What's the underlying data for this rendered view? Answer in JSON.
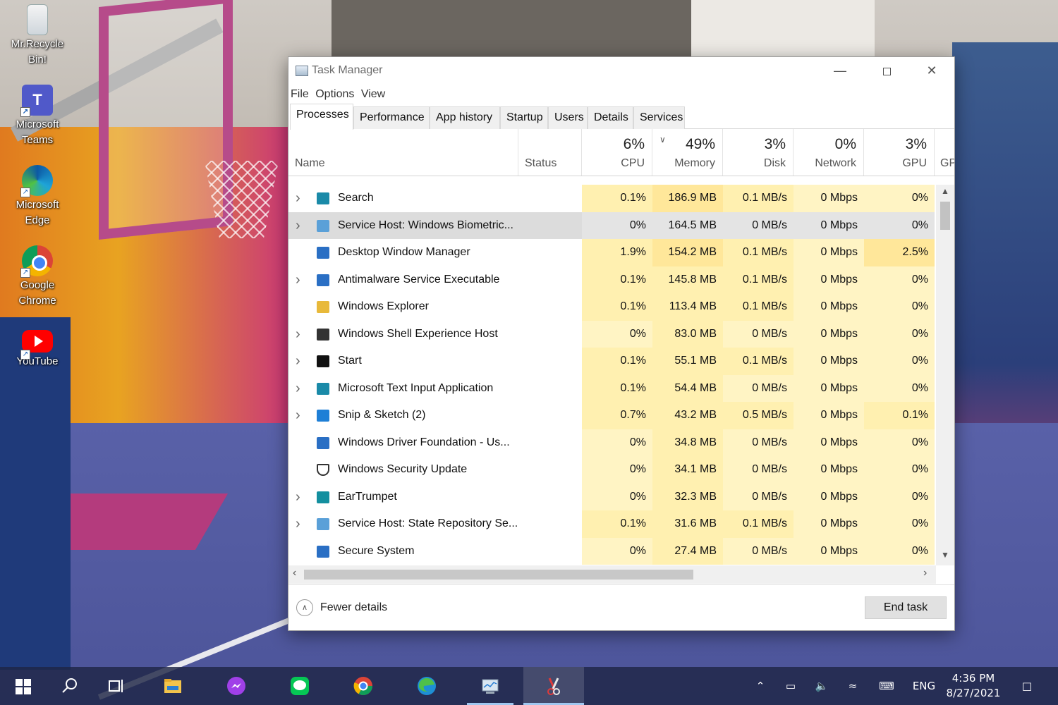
{
  "desktop": {
    "icons": [
      {
        "label_line1": "Mr.Recycle",
        "label_line2": "Bin!",
        "icon": "recycle-bin-icon"
      },
      {
        "label_line1": "Microsoft",
        "label_line2": "Teams",
        "icon": "teams-icon"
      },
      {
        "label_line1": "Microsoft",
        "label_line2": "Edge",
        "icon": "edge-icon"
      },
      {
        "label_line1": "Google",
        "label_line2": "Chrome",
        "icon": "chrome-icon"
      },
      {
        "label_line1": "YouTube",
        "label_line2": "",
        "icon": "youtube-icon"
      }
    ]
  },
  "window": {
    "title": "Task Manager",
    "controls": {
      "minimize": "—",
      "close": "✕"
    },
    "menu": [
      "File",
      "Options",
      "View"
    ],
    "tabs": [
      "Processes",
      "Performance",
      "App history",
      "Startup",
      "Users",
      "Details",
      "Services"
    ],
    "active_tab": "Processes"
  },
  "columns": {
    "name": {
      "label": "Name"
    },
    "status": {
      "label": "Status"
    },
    "cpu": {
      "pct": "6%",
      "label": "CPU"
    },
    "memory": {
      "pct": "49%",
      "label": "Memory"
    },
    "disk": {
      "pct": "3%",
      "label": "Disk"
    },
    "network": {
      "pct": "0%",
      "label": "Network"
    },
    "gpu": {
      "pct": "3%",
      "label": "GPU"
    },
    "gpu_engine": {
      "label": "GP"
    }
  },
  "processes": [
    {
      "name": "Search",
      "expandable": true,
      "icon": "search-app-icon",
      "color": "#1a8aa8",
      "cpu": "0.1%",
      "memory": "186.9 MB",
      "disk": "0.1 MB/s",
      "network": "0 Mbps",
      "gpu": "0%"
    },
    {
      "name": "Service Host: Windows Biometric...",
      "expandable": true,
      "icon": "gear-service-icon",
      "color": "#5aa0d8",
      "cpu": "0%",
      "memory": "164.5 MB",
      "disk": "0 MB/s",
      "network": "0 Mbps",
      "gpu": "0%",
      "selected": true
    },
    {
      "name": "Desktop Window Manager",
      "expandable": false,
      "icon": "window-app-icon",
      "color": "#2a6fc4",
      "cpu": "1.9%",
      "memory": "154.2 MB",
      "disk": "0.1 MB/s",
      "network": "0 Mbps",
      "gpu": "2.5%"
    },
    {
      "name": "Antimalware Service Executable",
      "expandable": true,
      "icon": "window-app-icon",
      "color": "#2a6fc4",
      "cpu": "0.1%",
      "memory": "145.8 MB",
      "disk": "0.1 MB/s",
      "network": "0 Mbps",
      "gpu": "0%"
    },
    {
      "name": "Windows Explorer",
      "expandable": false,
      "icon": "folder-icon",
      "color": "#e8b93a",
      "cpu": "0.1%",
      "memory": "113.4 MB",
      "disk": "0.1 MB/s",
      "network": "0 Mbps",
      "gpu": "0%"
    },
    {
      "name": "Windows Shell Experience Host",
      "expandable": true,
      "icon": "shell-app-icon",
      "color": "#333333",
      "cpu": "0%",
      "memory": "83.0 MB",
      "disk": "0 MB/s",
      "network": "0 Mbps",
      "gpu": "0%"
    },
    {
      "name": "Start",
      "expandable": true,
      "icon": "start-app-icon",
      "color": "#111111",
      "cpu": "0.1%",
      "memory": "55.1 MB",
      "disk": "0.1 MB/s",
      "network": "0 Mbps",
      "gpu": "0%"
    },
    {
      "name": "Microsoft Text Input Application",
      "expandable": true,
      "icon": "text-input-icon",
      "color": "#1a8aa8",
      "cpu": "0.1%",
      "memory": "54.4 MB",
      "disk": "0 MB/s",
      "network": "0 Mbps",
      "gpu": "0%"
    },
    {
      "name": "Snip & Sketch (2)",
      "expandable": true,
      "icon": "snip-sketch-icon",
      "color": "#1e7fd6",
      "cpu": "0.7%",
      "memory": "43.2 MB",
      "disk": "0.5 MB/s",
      "network": "0 Mbps",
      "gpu": "0.1%"
    },
    {
      "name": "Windows Driver Foundation - Us...",
      "expandable": false,
      "icon": "window-app-icon",
      "color": "#2a6fc4",
      "cpu": "0%",
      "memory": "34.8 MB",
      "disk": "0 MB/s",
      "network": "0 Mbps",
      "gpu": "0%"
    },
    {
      "name": "Windows Security Update",
      "expandable": false,
      "icon": "shield-icon",
      "color": "#ffffff",
      "cpu": "0%",
      "memory": "34.1 MB",
      "disk": "0 MB/s",
      "network": "0 Mbps",
      "gpu": "0%"
    },
    {
      "name": "EarTrumpet",
      "expandable": true,
      "icon": "eartrumpet-icon",
      "color": "#138f9f",
      "cpu": "0%",
      "memory": "32.3 MB",
      "disk": "0 MB/s",
      "network": "0 Mbps",
      "gpu": "0%"
    },
    {
      "name": "Service Host: State Repository Se...",
      "expandable": true,
      "icon": "gear-service-icon",
      "color": "#5aa0d8",
      "cpu": "0.1%",
      "memory": "31.6 MB",
      "disk": "0.1 MB/s",
      "network": "0 Mbps",
      "gpu": "0%"
    },
    {
      "name": "Secure System",
      "expandable": false,
      "icon": "window-app-icon",
      "color": "#2a6fc4",
      "cpu": "0%",
      "memory": "27.4 MB",
      "disk": "0 MB/s",
      "network": "0 Mbps",
      "gpu": "0%"
    }
  ],
  "footer": {
    "fewer_details": "Fewer details",
    "end_task": "End task"
  },
  "heat_colors": {
    "light": "#fff4c4",
    "medium": "#fff0b0",
    "strong": "#ffe79a"
  },
  "taskbar": {
    "language": "ENG",
    "time": "4:36 PM",
    "date": "8/27/2021"
  }
}
